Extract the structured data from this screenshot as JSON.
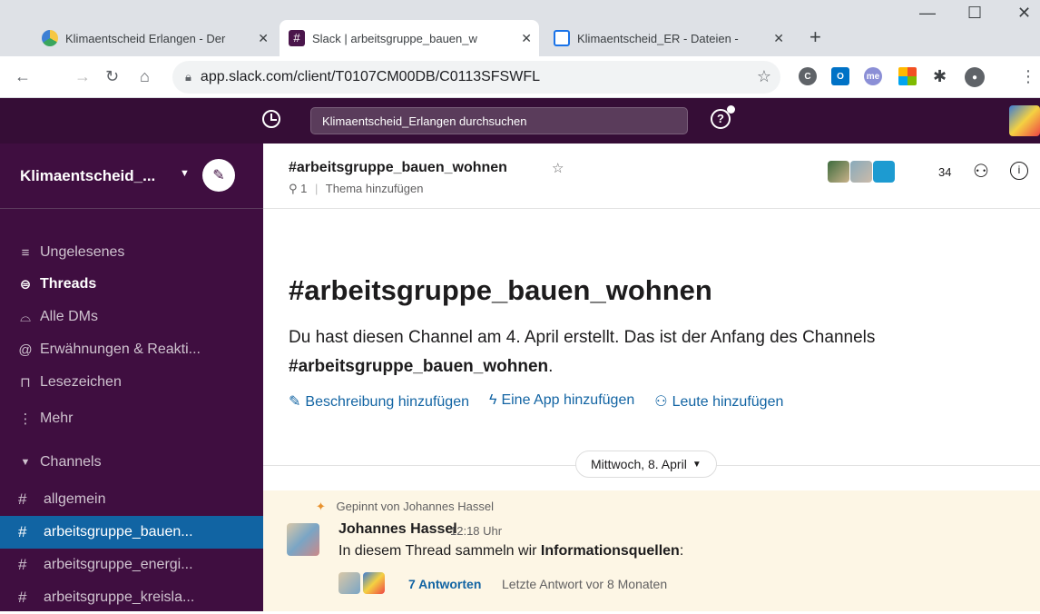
{
  "browser": {
    "tabs": [
      {
        "title": "Klimaentscheid Erlangen - Der",
        "icon": "klimaentscheid-favicon",
        "active": false
      },
      {
        "title": "Slack | arbeitsgruppe_bauen_w",
        "icon": "slack-favicon",
        "active": true
      },
      {
        "title": "Klimaentscheid_ER - Dateien -",
        "icon": "drive-favicon",
        "active": false
      }
    ],
    "new_tab": "+",
    "window_controls": {
      "minimize": "—",
      "maximize": "☐",
      "close": "✕"
    },
    "url": "app.slack.com/client/T0107CM00DB/C0113SFSWFL"
  },
  "slack": {
    "search_placeholder": "Klimaentscheid_Erlangen durchsuchen",
    "workspace": "Klimaentscheid_...",
    "nav": [
      {
        "label": "Ungelesenes",
        "icon": "unread-icon",
        "glyph": "≡",
        "bold": false
      },
      {
        "label": "Threads",
        "icon": "threads-icon",
        "glyph": "⊜",
        "bold": true
      },
      {
        "label": "Alle DMs",
        "icon": "dms-icon",
        "glyph": "⌓",
        "bold": false
      },
      {
        "label": "Erwähnungen & Reakti...",
        "icon": "mentions-icon",
        "glyph": "@",
        "bold": false
      },
      {
        "label": "Lesezeichen",
        "icon": "bookmark-icon",
        "glyph": "⊓",
        "bold": false
      },
      {
        "label": "Mehr",
        "icon": "more-icon",
        "glyph": "⋮",
        "bold": false
      }
    ],
    "channels_header": "Channels",
    "channels": [
      {
        "name": "allgemein",
        "active": false
      },
      {
        "name": "arbeitsgruppe_bauen...",
        "active": true
      },
      {
        "name": "arbeitsgruppe_energi...",
        "active": false
      },
      {
        "name": "arbeitsgruppe_kreisla...",
        "active": false
      }
    ],
    "channel": {
      "title": "#arbeitsgruppe_bauen_wohnen",
      "pins": "1",
      "topic": "Thema hinzufügen",
      "member_count": "34"
    },
    "intro": {
      "title": "#arbeitsgruppe_bauen_wohnen",
      "text": "Du hast diesen Channel am 4. April erstellt. Das ist der Anfang des Channels",
      "channel_bold": "#arbeitsgruppe_bauen_wohnen",
      "period": ".",
      "actions": [
        "Beschreibung hinzufügen",
        "Eine App hinzufügen",
        "Leute hinzufügen"
      ]
    },
    "date_divider": "Mittwoch, 8. April",
    "message": {
      "pinned_by": "Gepinnt von Johannes Hassel",
      "author": "Johannes Hassel",
      "time": "12:18 Uhr",
      "text_prefix": "In diesem Thread sammeln wir ",
      "text_bold": "Informationsquellen",
      "text_suffix": ":",
      "replies": "7 Antworten",
      "last_reply": "Letzte Antwort vor 8 Monaten"
    }
  }
}
